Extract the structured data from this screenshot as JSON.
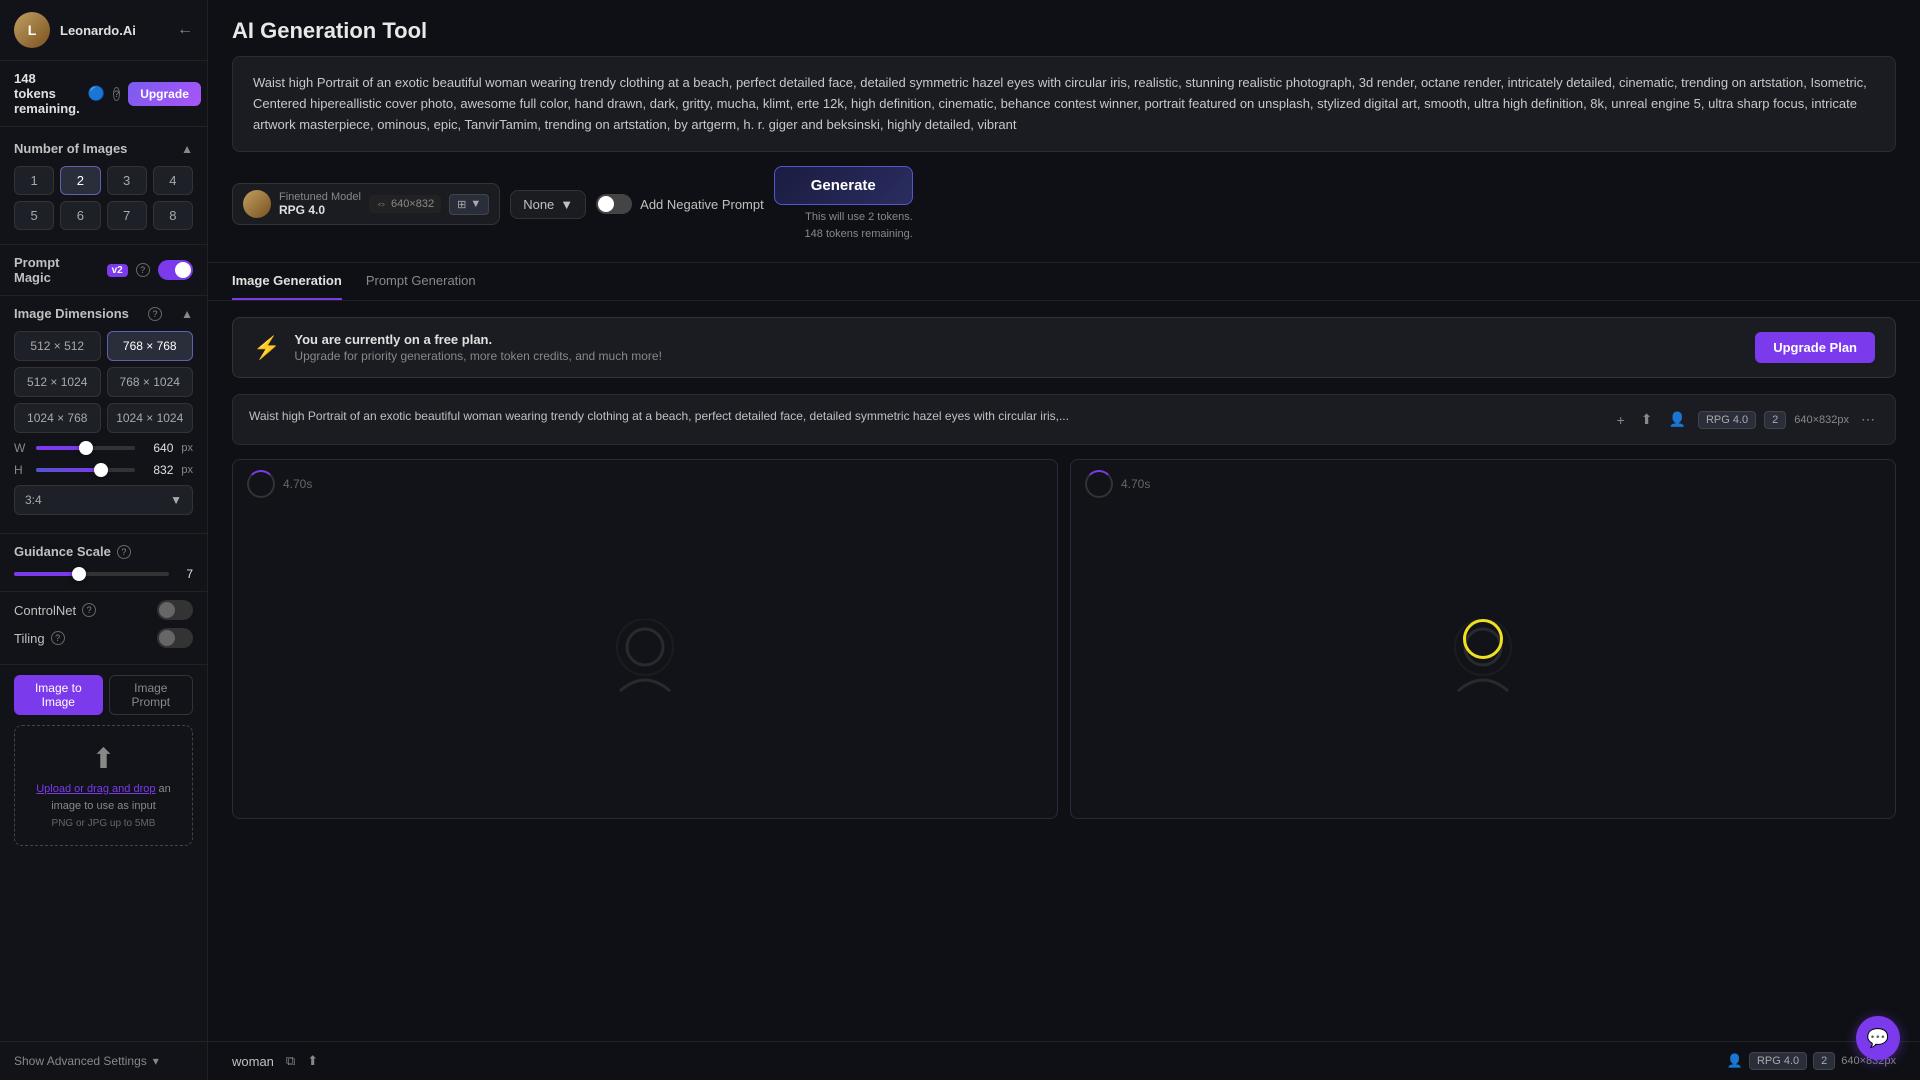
{
  "sidebar": {
    "username": "Leonardo.Ai",
    "token_count": "148",
    "upgrade_label": "Upgrade",
    "num_images_title": "Number of Images",
    "num_buttons": [
      "1",
      "2",
      "3",
      "4",
      "5",
      "6",
      "7",
      "8"
    ],
    "active_num": "2",
    "prompt_magic_label": "Prompt Magic",
    "pm_badge": "v2",
    "image_dimensions_title": "Image Dimensions",
    "dim_buttons": [
      {
        "label": "512 × 512",
        "active": false
      },
      {
        "label": "768 × 768",
        "active": true
      },
      {
        "label": "512 × 1024",
        "active": false
      },
      {
        "label": "768 × 1024",
        "active": false
      },
      {
        "label": "1024 × 768",
        "active": false
      },
      {
        "label": "1024 × 1024",
        "active": false
      }
    ],
    "width_label": "W",
    "width_value": "640",
    "width_unit": "px",
    "height_label": "H",
    "height_value": "832",
    "height_unit": "px",
    "aspect_ratio": "3:4",
    "guidance_scale_title": "Guidance Scale",
    "guidance_value": "7",
    "controlnet_label": "ControlNet",
    "tiling_label": "Tiling",
    "i2i_tab_active": "Image to Image",
    "i2i_tab_inactive": "Image Prompt",
    "upload_text": "Upload or drag and drop",
    "upload_hint": "an image to use as input",
    "file_hint": "PNG or JPG up to 5MB",
    "advanced_settings": "Show Advanced Settings"
  },
  "main": {
    "title": "AI Generation Tool",
    "prompt_text": "Waist high Portrait of an exotic beautiful woman wearing trendy clothing at a beach,  perfect detailed face, detailed symmetric hazel eyes with circular iris, realistic, stunning realistic photograph, 3d render, octane render, intricately detailed, cinematic, trending on artstation, Isometric, Centered hipereallistic cover photo, awesome full color, hand drawn, dark, gritty, mucha, klimt, erte 12k, high definition, cinematic, behance contest winner, portrait featured on unsplash, stylized digital art, smooth, ultra high definition, 8k, unreal engine 5, ultra sharp focus, intricate artwork masterpiece, ominous, epic, TanvirTamim, trending on artstation, by artgerm, h. r. giger and beksinski, highly detailed, vibrant",
    "model_name": "Finetuned Model",
    "model_version": "RPG 4.0",
    "model_resolution": "640×832",
    "none_label": "None",
    "neg_prompt_label": "Add Negative Prompt",
    "generate_label": "Generate",
    "generate_info_1": "This will use 2 tokens.",
    "generate_info_2": "148 tokens remaining.",
    "tab_image_gen": "Image Generation",
    "tab_prompt_gen": "Prompt Generation",
    "banner_title": "You are currently on a free plan.",
    "banner_subtitle": "Upgrade for priority generations, more token credits, and much more!",
    "upgrade_plan_label": "Upgrade Plan",
    "gen_prompt_short": "Waist high Portrait of an exotic beautiful woman wearing trendy clothing at a beach, perfect detailed face, detailed symmetric hazel eyes with circular iris,...",
    "gen_rpg": "RPG 4.0",
    "gen_count": "2",
    "gen_size": "640×832px",
    "timer1": "4.70s",
    "timer2": "4.70s",
    "bottom_prompt": "woman",
    "bottom_rpg": "RPG 4.0",
    "bottom_count": "2",
    "bottom_size": "640×832px",
    "chat_icon": "💬"
  }
}
